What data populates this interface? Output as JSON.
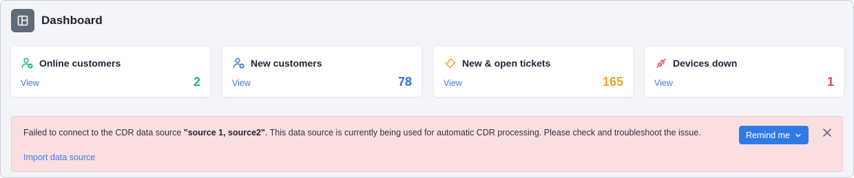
{
  "header": {
    "title": "Dashboard",
    "icon": "dashboard-layout-icon"
  },
  "cards": [
    {
      "label": "Online customers",
      "link": "View",
      "value": "2",
      "icon": "online-customers-icon",
      "color": "#21b573"
    },
    {
      "label": "New customers",
      "link": "View",
      "value": "78",
      "icon": "new-customers-icon",
      "color": "#2f6fd8"
    },
    {
      "label": "New & open tickets",
      "link": "View",
      "value": "165",
      "icon": "ticket-icon",
      "color": "#f2a21e"
    },
    {
      "label": "Devices down",
      "link": "View",
      "value": "1",
      "icon": "disconnected-plug-icon",
      "color": "#e5484d"
    }
  ],
  "alert": {
    "message_prefix": "Failed to connect to the CDR data source ",
    "message_sources": "\"source 1, source2\"",
    "message_suffix": ". This data source is currently being used for automatic CDR processing. Please check and troubleshoot the issue.",
    "link": "Import data source",
    "remind_label": "Remind me",
    "background": "#fbdfe0",
    "button_color": "#2f7be6"
  }
}
